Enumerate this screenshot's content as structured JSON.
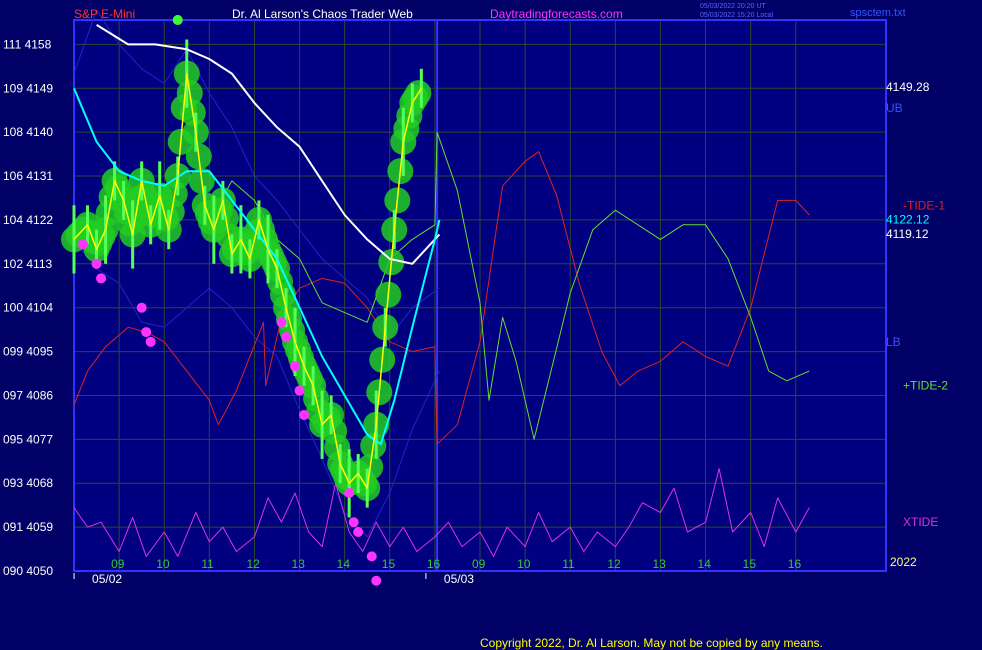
{
  "header": {
    "instrument": "S&P E-Mini",
    "site": "Dr. Al Larson's Chaos Trader Web",
    "url": "Daytradingforecasts.com",
    "time_ut": "05/03/2022 20:20 UT",
    "time_local": "05/03/2022 15:20 Local",
    "file": "spsctem.txt"
  },
  "footer": {
    "copyright": "Copyright 2022, Dr. Al Larson. May not be copied by any means."
  },
  "colors": {
    "background": "#000066",
    "plot_bg": "#000080",
    "grid": "#2a4a2a",
    "axis": "#3333ff",
    "price": "#ffff00",
    "fast_ma": "#00ffff",
    "slow_ma": "#ffffff",
    "band": "#2222cc",
    "bubble": "#22cc22",
    "dot": "#ff33ff",
    "tide1": "#dd2222",
    "tide2": "#66dd33",
    "xtide": "#dd33dd"
  },
  "chart_data": {
    "type": "line",
    "title": "S&P E-Mini",
    "y_left_labels": [
      {
        "price": 4158,
        "label": "111"
      },
      {
        "price": 4149,
        "label": "109"
      },
      {
        "price": 4140,
        "label": "108"
      },
      {
        "price": 4131,
        "label": "106"
      },
      {
        "price": 4122,
        "label": "104"
      },
      {
        "price": 4113,
        "label": "102"
      },
      {
        "price": 4104,
        "label": "100"
      },
      {
        "price": 4095,
        "label": "099"
      },
      {
        "price": 4086,
        "label": "097"
      },
      {
        "price": 4077,
        "label": "095"
      },
      {
        "price": 4068,
        "label": "093"
      },
      {
        "price": 4059,
        "label": "091"
      },
      {
        "price": 4050,
        "label": "090"
      }
    ],
    "ylim": [
      4050,
      4163
    ],
    "xlim": [
      8,
      26
    ],
    "x_ticks": [
      {
        "x": 9,
        "label": "09"
      },
      {
        "x": 10,
        "label": "10"
      },
      {
        "x": 11,
        "label": "11"
      },
      {
        "x": 12,
        "label": "12"
      },
      {
        "x": 13,
        "label": "13"
      },
      {
        "x": 14,
        "label": "14"
      },
      {
        "x": 15,
        "label": "15"
      },
      {
        "x": 16,
        "label": "16"
      },
      {
        "x": 17,
        "label": "09"
      },
      {
        "x": 18,
        "label": "10"
      },
      {
        "x": 19,
        "label": "11"
      },
      {
        "x": 20,
        "label": "12"
      },
      {
        "x": 21,
        "label": "13"
      },
      {
        "x": 22,
        "label": "14"
      },
      {
        "x": 23,
        "label": "15"
      },
      {
        "x": 24,
        "label": "16"
      }
    ],
    "dates": [
      {
        "x": 8.4,
        "label": "05/02"
      },
      {
        "x": 16.2,
        "label": "05/03"
      }
    ],
    "year_label": "2022",
    "right_labels": [
      {
        "text": "4149.28",
        "price": 4149.3,
        "color": "#ffffff"
      },
      {
        "text": "UB",
        "price": 4145,
        "color": "#3355ff"
      },
      {
        "text": "-TIDE-1",
        "price": 4125,
        "color": "#dd2222"
      },
      {
        "text": "4122.12",
        "price": 4122.1,
        "color": "#00ffff"
      },
      {
        "text": "4119.12",
        "price": 4119.1,
        "color": "#ffffff"
      },
      {
        "text": "LB",
        "price": 4097,
        "color": "#3355ff"
      },
      {
        "text": "+TIDE-2",
        "price": 4088,
        "color": "#66dd33"
      },
      {
        "text": "XTIDE",
        "price": 4060,
        "color": "#dd33dd"
      }
    ],
    "series": [
      {
        "name": "S&P E-Mini",
        "role": "price",
        "values": [
          [
            8,
            4118
          ],
          [
            8.3,
            4121
          ],
          [
            8.5,
            4116
          ],
          [
            8.7,
            4120
          ],
          [
            8.9,
            4130
          ],
          [
            9.1,
            4126
          ],
          [
            9.3,
            4119
          ],
          [
            9.5,
            4130
          ],
          [
            9.7,
            4121
          ],
          [
            9.9,
            4127
          ],
          [
            10.1,
            4120
          ],
          [
            10.3,
            4131
          ],
          [
            10.5,
            4152
          ],
          [
            10.7,
            4140
          ],
          [
            10.9,
            4125
          ],
          [
            11.1,
            4120
          ],
          [
            11.3,
            4126
          ],
          [
            11.5,
            4115
          ],
          [
            11.7,
            4118
          ],
          [
            11.9,
            4114
          ],
          [
            12.1,
            4122
          ],
          [
            12.3,
            4116
          ],
          [
            12.5,
            4112
          ],
          [
            12.7,
            4104
          ],
          [
            12.9,
            4097
          ],
          [
            13.1,
            4092
          ],
          [
            13.3,
            4088
          ],
          [
            13.5,
            4080
          ],
          [
            13.7,
            4082
          ],
          [
            13.9,
            4072
          ],
          [
            14.1,
            4068
          ],
          [
            14.3,
            4070
          ],
          [
            14.5,
            4067
          ],
          [
            14.7,
            4080
          ],
          [
            14.9,
            4100
          ],
          [
            15.1,
            4120
          ],
          [
            15.3,
            4138
          ],
          [
            15.5,
            4146
          ],
          [
            15.7,
            4149
          ]
        ]
      },
      {
        "name": "fast_ma",
        "role": "fast",
        "values": [
          [
            8,
            4149
          ],
          [
            8.5,
            4138
          ],
          [
            9,
            4132
          ],
          [
            9.5,
            4130
          ],
          [
            10,
            4129
          ],
          [
            10.5,
            4132
          ],
          [
            11,
            4132
          ],
          [
            11.5,
            4126
          ],
          [
            12,
            4120
          ],
          [
            12.5,
            4114
          ],
          [
            13,
            4104
          ],
          [
            13.5,
            4094
          ],
          [
            14,
            4086
          ],
          [
            14.5,
            4078
          ],
          [
            14.8,
            4076
          ],
          [
            15.1,
            4085
          ],
          [
            15.5,
            4100
          ],
          [
            16,
            4118
          ],
          [
            16.1,
            4122
          ]
        ]
      },
      {
        "name": "slow_ma",
        "role": "slow",
        "values": [
          [
            8.5,
            4162
          ],
          [
            9.2,
            4158
          ],
          [
            9.8,
            4158
          ],
          [
            10.5,
            4157
          ],
          [
            11,
            4155
          ],
          [
            11.5,
            4152
          ],
          [
            12,
            4146
          ],
          [
            12.5,
            4141
          ],
          [
            13,
            4137
          ],
          [
            13.5,
            4130
          ],
          [
            14,
            4123
          ],
          [
            14.5,
            4118
          ],
          [
            15,
            4114
          ],
          [
            15.5,
            4113
          ],
          [
            16.1,
            4119
          ]
        ]
      },
      {
        "name": "upper_band",
        "role": "band",
        "values": [
          [
            8,
            4152
          ],
          [
            8.5,
            4165
          ],
          [
            9,
            4158
          ],
          [
            9.5,
            4153
          ],
          [
            10,
            4150
          ],
          [
            10.5,
            4157
          ],
          [
            11,
            4148
          ],
          [
            11.5,
            4141
          ],
          [
            12,
            4131
          ],
          [
            12.5,
            4126
          ],
          [
            13,
            4120
          ],
          [
            13.5,
            4114
          ],
          [
            14,
            4110
          ],
          [
            14.5,
            4106
          ],
          [
            15,
            4098
          ],
          [
            15.5,
            4104
          ],
          [
            16.1,
            4108
          ]
        ]
      },
      {
        "name": "lower_band",
        "role": "band",
        "values": [
          [
            8,
            4118
          ],
          [
            8.5,
            4112
          ],
          [
            9,
            4109
          ],
          [
            9.5,
            4101
          ],
          [
            10,
            4100
          ],
          [
            10.5,
            4104
          ],
          [
            11,
            4108
          ],
          [
            11.5,
            4104
          ],
          [
            12,
            4098
          ],
          [
            12.5,
            4094
          ],
          [
            13,
            4083
          ],
          [
            13.5,
            4073
          ],
          [
            14,
            4062
          ],
          [
            14.5,
            4057
          ],
          [
            15,
            4066
          ],
          [
            15.5,
            4079
          ],
          [
            16.1,
            4091
          ]
        ]
      },
      {
        "name": "TIDE-1",
        "role": "tide1",
        "values": [
          [
            8,
            4084
          ],
          [
            8.3,
            4091
          ],
          [
            8.7,
            4096
          ],
          [
            9.2,
            4100
          ],
          [
            9.6,
            4099
          ],
          [
            10,
            4097
          ],
          [
            10.5,
            4091
          ],
          [
            11,
            4085
          ],
          [
            11.2,
            4080
          ],
          [
            11.6,
            4087
          ],
          [
            12.2,
            4101
          ],
          [
            12.25,
            4088
          ],
          [
            12.6,
            4102
          ],
          [
            13,
            4108
          ],
          [
            13.5,
            4110
          ],
          [
            14,
            4109
          ],
          [
            14.5,
            4104
          ],
          [
            15,
            4097
          ],
          [
            15.5,
            4095
          ],
          [
            16,
            4096
          ],
          [
            16.05,
            4076
          ],
          [
            16.5,
            4080
          ],
          [
            17,
            4097
          ],
          [
            17.5,
            4129
          ],
          [
            18,
            4134
          ],
          [
            18.3,
            4136
          ],
          [
            18.7,
            4127
          ],
          [
            19.2,
            4109
          ],
          [
            19.7,
            4095
          ],
          [
            20.1,
            4088
          ],
          [
            20.5,
            4091
          ],
          [
            21,
            4093
          ],
          [
            21.5,
            4097
          ],
          [
            22,
            4094
          ],
          [
            22.5,
            4092
          ],
          [
            23,
            4104
          ],
          [
            23.6,
            4126
          ],
          [
            24,
            4126
          ],
          [
            24.3,
            4123
          ]
        ]
      },
      {
        "name": "TIDE-2",
        "role": "tide2",
        "values": [
          [
            11,
            4122
          ],
          [
            11.5,
            4130
          ],
          [
            12,
            4126
          ],
          [
            12.5,
            4118
          ],
          [
            13,
            4114
          ],
          [
            13.5,
            4105
          ],
          [
            14,
            4103
          ],
          [
            14.5,
            4101
          ],
          [
            15,
            4114
          ],
          [
            15.5,
            4118
          ],
          [
            16,
            4121
          ],
          [
            16.05,
            4140
          ],
          [
            16.5,
            4128
          ],
          [
            17,
            4105
          ],
          [
            17.2,
            4085
          ],
          [
            17.5,
            4102
          ],
          [
            17.8,
            4093
          ],
          [
            18.2,
            4077
          ],
          [
            18.6,
            4092
          ],
          [
            19,
            4107
          ],
          [
            19.5,
            4120
          ],
          [
            20,
            4124
          ],
          [
            20.5,
            4121
          ],
          [
            21,
            4118
          ],
          [
            21.5,
            4121
          ],
          [
            22,
            4121
          ],
          [
            22.5,
            4114
          ],
          [
            23,
            4102
          ],
          [
            23.4,
            4091
          ],
          [
            23.8,
            4089
          ],
          [
            24.3,
            4091
          ]
        ]
      },
      {
        "name": "XTIDE",
        "role": "xtide",
        "values": [
          [
            8,
            4063
          ],
          [
            8.3,
            4059
          ],
          [
            8.6,
            4060
          ],
          [
            9,
            4054
          ],
          [
            9.3,
            4061
          ],
          [
            9.6,
            4053
          ],
          [
            10,
            4058
          ],
          [
            10.3,
            4053
          ],
          [
            10.7,
            4062
          ],
          [
            11,
            4056
          ],
          [
            11.3,
            4059
          ],
          [
            11.6,
            4054
          ],
          [
            12,
            4057
          ],
          [
            12.3,
            4065
          ],
          [
            12.6,
            4060
          ],
          [
            12.9,
            4066
          ],
          [
            13.2,
            4058
          ],
          [
            13.5,
            4055
          ],
          [
            13.8,
            4068
          ],
          [
            14.1,
            4058
          ],
          [
            14.4,
            4054
          ],
          [
            14.7,
            4060
          ],
          [
            15,
            4055
          ],
          [
            15.3,
            4059
          ],
          [
            15.6,
            4054
          ],
          [
            16,
            4057
          ],
          [
            16.3,
            4060
          ],
          [
            16.6,
            4055
          ],
          [
            17,
            4058
          ],
          [
            17.3,
            4053
          ],
          [
            17.6,
            4059
          ],
          [
            18,
            4055
          ],
          [
            18.3,
            4062
          ],
          [
            18.6,
            4056
          ],
          [
            19,
            4059
          ],
          [
            19.3,
            4054
          ],
          [
            19.6,
            4058
          ],
          [
            20,
            4055
          ],
          [
            20.3,
            4059
          ],
          [
            20.6,
            4064
          ],
          [
            21,
            4062
          ],
          [
            21.3,
            4067
          ],
          [
            21.6,
            4058
          ],
          [
            22,
            4060
          ],
          [
            22.3,
            4071
          ],
          [
            22.6,
            4058
          ],
          [
            23,
            4062
          ],
          [
            23.3,
            4055
          ],
          [
            23.6,
            4065
          ],
          [
            24,
            4058
          ],
          [
            24.3,
            4063
          ]
        ]
      }
    ],
    "highlighted_points": [
      [
        8.2,
        4117
      ],
      [
        8.5,
        4113
      ],
      [
        8.6,
        4110
      ],
      [
        9.5,
        4104
      ],
      [
        9.6,
        4099
      ],
      [
        9.7,
        4097
      ],
      [
        10.3,
        4163
      ],
      [
        12.6,
        4101
      ],
      [
        12.7,
        4098
      ],
      [
        12.9,
        4092
      ],
      [
        13.0,
        4087
      ],
      [
        13.1,
        4082
      ],
      [
        14.1,
        4066
      ],
      [
        14.2,
        4060
      ],
      [
        14.3,
        4058
      ],
      [
        14.6,
        4053
      ],
      [
        14.7,
        4048
      ]
    ]
  }
}
